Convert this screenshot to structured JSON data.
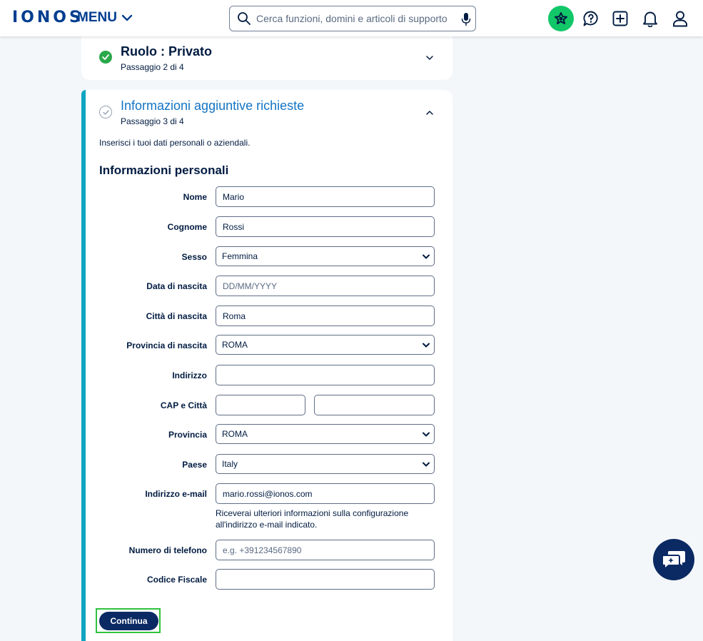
{
  "header": {
    "logo": "IONOS",
    "menu_label": "MENU",
    "search_placeholder": "Cerca funzioni, domini e articoli di supporto"
  },
  "colors": {
    "brand": "#003d8f",
    "accent": "#0fa5c2",
    "success": "#2aa84a",
    "star_bg": "#11c768",
    "button_bg": "#0b2a63",
    "link_blue": "#1474c4"
  },
  "steps": [
    {
      "title": "Ruolo : Privato",
      "subtitle": "Passaggio 2 di 4",
      "state": "completed"
    },
    {
      "title": "Informazioni aggiuntive richieste",
      "subtitle": "Passaggio 3 di 4",
      "state": "active"
    }
  ],
  "form": {
    "intro": "Inserisci i tuoi dati personali o aziendali.",
    "section_title": "Informazioni personali",
    "fields": {
      "nome": {
        "label": "Nome",
        "value": "Mario"
      },
      "cognome": {
        "label": "Cognome",
        "value": "Rossi"
      },
      "sesso": {
        "label": "Sesso",
        "value": "Femmina"
      },
      "data_nascita": {
        "label": "Data di nascita",
        "value": "",
        "placeholder": "DD/MM/YYYY"
      },
      "citta_nascita": {
        "label": "Città di nascita",
        "value": "Roma"
      },
      "provincia_nascita": {
        "label": "Provincia di nascita",
        "value": "ROMA"
      },
      "indirizzo": {
        "label": "Indirizzo",
        "value": ""
      },
      "cap_citta": {
        "label": "CAP e Città",
        "cap": "",
        "citta": ""
      },
      "provincia": {
        "label": "Provincia",
        "value": "ROMA"
      },
      "paese": {
        "label": "Paese",
        "value": "Italy"
      },
      "email": {
        "label": "Indirizzo e-mail",
        "value": "mario.rossi@ionos.com",
        "hint": "Riceverai ulteriori informazioni sulla configurazione all'indirizzo e-mail indicato."
      },
      "telefono": {
        "label": "Numero di telefono",
        "value": "",
        "placeholder": "e.g. +391234567890"
      },
      "codice_fiscale": {
        "label": "Codice Fiscale",
        "value": ""
      }
    },
    "submit_label": "Continua"
  }
}
